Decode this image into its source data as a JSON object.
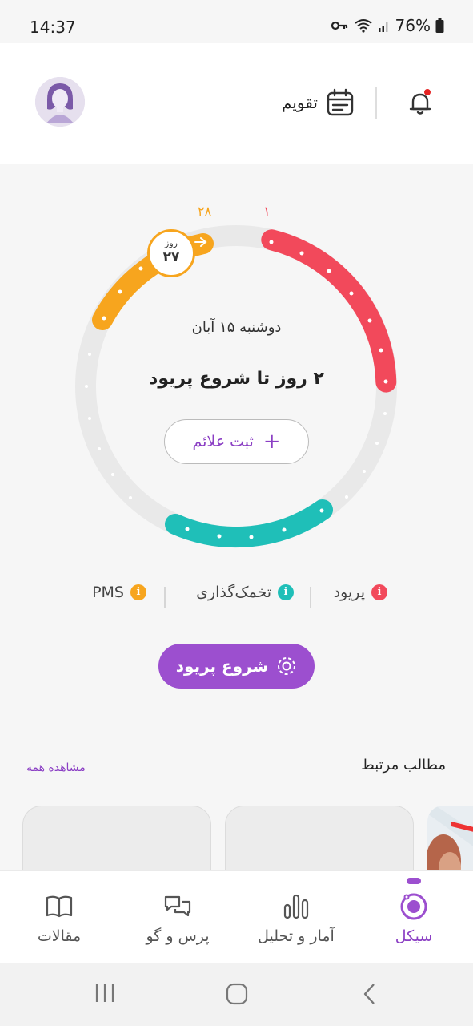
{
  "status_bar": {
    "time": "14:37",
    "battery": "76%",
    "icons": [
      "key-icon",
      "wifi-icon",
      "signal-icon",
      "battery-icon"
    ]
  },
  "header": {
    "calendar_label": "تقویم",
    "icons": [
      "avatar",
      "calendar-icon",
      "bell-icon"
    ],
    "notification_dot_color": "#e52222"
  },
  "cycle": {
    "top_left_label": "۲۸",
    "top_right_label": "۱",
    "date": "دوشنبه ۱۵ آبان",
    "countdown": "۲ روز تا شروع پریود",
    "symptom_button": "ثبت علائم",
    "day_badge": {
      "label": "روز",
      "value": "۲۷"
    },
    "colors": {
      "period": "#f2495b",
      "ovulation": "#1fbfb8",
      "pms": "#f7a51e",
      "track": "#e9e9e9"
    }
  },
  "legend": [
    {
      "label": "پریود",
      "color": "#f2495b",
      "icon": "info-icon"
    },
    {
      "label": "تخمک‌گذاری",
      "color": "#1fbfb8",
      "icon": "info-icon"
    },
    {
      "label": "PMS",
      "color": "#f7a51e",
      "icon": "info-icon"
    }
  ],
  "start_button": {
    "label": "شروع پریود",
    "icon": "cycle-start-icon"
  },
  "related": {
    "title": "مطالب مرتبط",
    "see_all": "مشاهده همه"
  },
  "bottom_nav": {
    "items": [
      {
        "label": "سیکل",
        "icon": "cycle-icon",
        "active": true
      },
      {
        "label": "آمار و تحلیل",
        "icon": "bar-chart-icon",
        "active": false
      },
      {
        "label": "پرس و گو",
        "icon": "chat-icon",
        "active": false
      },
      {
        "label": "مقالات",
        "icon": "book-icon",
        "active": false
      }
    ],
    "active_color": "#8b3fc4"
  },
  "android_nav": [
    "recents-button",
    "home-button",
    "back-button"
  ]
}
